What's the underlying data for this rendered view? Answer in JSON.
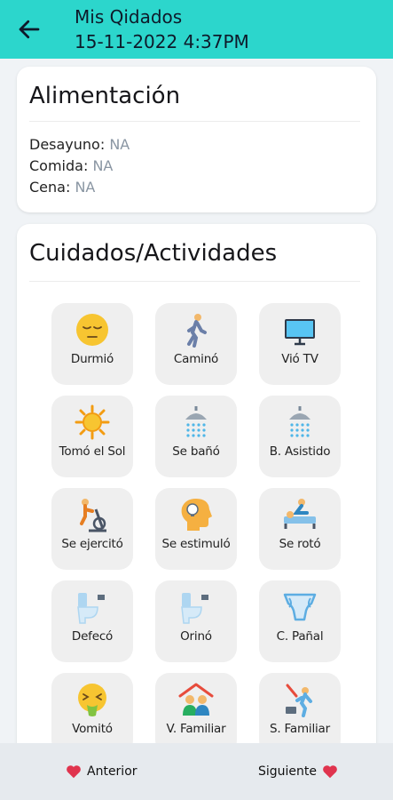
{
  "header": {
    "title": "Mis Qidados",
    "datetime": "15-11-2022 4:37PM",
    "back_icon": "arrow-left-icon",
    "color": "#2cd6cc"
  },
  "food": {
    "title": "Alimentación",
    "items": [
      {
        "label": "Desayuno:",
        "value": "NA"
      },
      {
        "label": "Comida:",
        "value": "NA"
      },
      {
        "label": "Cena:",
        "value": "NA"
      }
    ]
  },
  "care": {
    "title": "Cuidados/Actividades",
    "tiles": [
      {
        "label": "Durmió",
        "icon": "sleeping-face-icon"
      },
      {
        "label": "Caminó",
        "icon": "walking-person-icon"
      },
      {
        "label": "Vió TV",
        "icon": "tv-monitor-icon"
      },
      {
        "label": "Tomó el Sol",
        "icon": "sun-icon"
      },
      {
        "label": "Se bañó",
        "icon": "shower-icon"
      },
      {
        "label": "B. Asistido",
        "icon": "shower-icon"
      },
      {
        "label": "Se ejercitó",
        "icon": "exercise-bike-icon"
      },
      {
        "label": "Se estimuló",
        "icon": "head-lightbulb-icon"
      },
      {
        "label": "Se rotó",
        "icon": "patient-bed-icon"
      },
      {
        "label": "Defecó",
        "icon": "toilet-icon"
      },
      {
        "label": "Orinó",
        "icon": "toilet-icon"
      },
      {
        "label": "C. Pañal",
        "icon": "diaper-icon"
      },
      {
        "label": "Vomitó",
        "icon": "vomiting-face-icon"
      },
      {
        "label": "V. Familiar",
        "icon": "family-house-icon"
      },
      {
        "label": "S. Familiar",
        "icon": "person-leaving-icon"
      }
    ]
  },
  "footer": {
    "prev_label": "Anterior",
    "next_label": "Siguiente",
    "heart_color": "#e0344e"
  }
}
